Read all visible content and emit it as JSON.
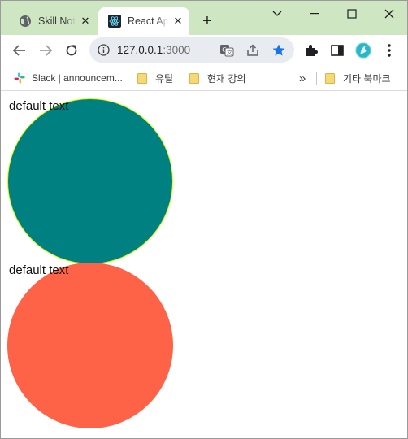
{
  "browser": {
    "tabs": [
      {
        "title": "Skill Notes",
        "active": false,
        "icon": "globe-icon"
      },
      {
        "title": "React App",
        "active": true,
        "icon": "react-icon"
      }
    ],
    "new_tab_label": "+",
    "window_controls": [
      "chevron-down-icon",
      "minimize-icon",
      "maximize-icon",
      "close-icon"
    ]
  },
  "toolbar": {
    "url_host": "127.0.0.1",
    "url_port": ":3000",
    "bookmark_star_color": "#1a73e8"
  },
  "bookmarks": {
    "items": [
      {
        "label": "Slack | announcem...",
        "icon": "slack-icon"
      },
      {
        "label": "유틸",
        "icon": "folder-icon"
      },
      {
        "label": "현재 강의",
        "icon": "folder-icon"
      }
    ],
    "overflow_label": "»",
    "other_label": "기타 북마크"
  },
  "page": {
    "blocks": [
      {
        "text": "default text",
        "color": "#008080",
        "border": "#d9ff00"
      },
      {
        "text": "default text",
        "color": "#ff6347"
      }
    ]
  }
}
